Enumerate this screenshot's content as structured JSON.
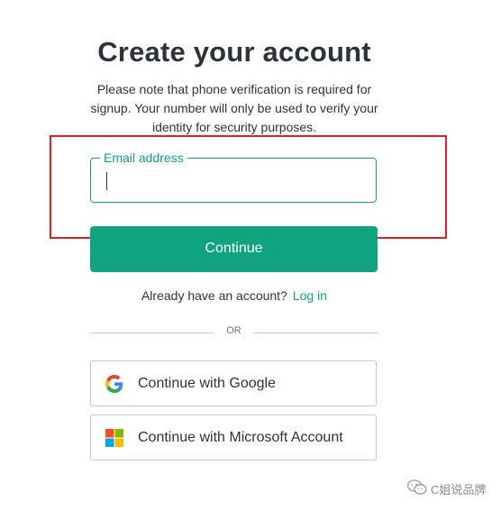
{
  "header": {
    "title": "Create your account",
    "subtitle": "Please note that phone verification is required for signup. Your number will only be used to verify your identity for security purposes."
  },
  "form": {
    "email_label": "Email address",
    "email_value": "",
    "continue_label": "Continue"
  },
  "login": {
    "prompt": "Already have an account?",
    "link_label": "Log in"
  },
  "divider": {
    "text": "OR"
  },
  "social": {
    "google_label": "Continue with Google",
    "google_icon": "google-icon",
    "microsoft_label": "Continue with Microsoft Account",
    "microsoft_icon": "microsoft-icon"
  },
  "watermark": {
    "text": "C姐说品牌",
    "icon": "wechat-icon"
  },
  "colors": {
    "accent": "#10a37f",
    "text": "#2d333a",
    "border": "#c2c8d0",
    "highlight": "#e02020"
  }
}
